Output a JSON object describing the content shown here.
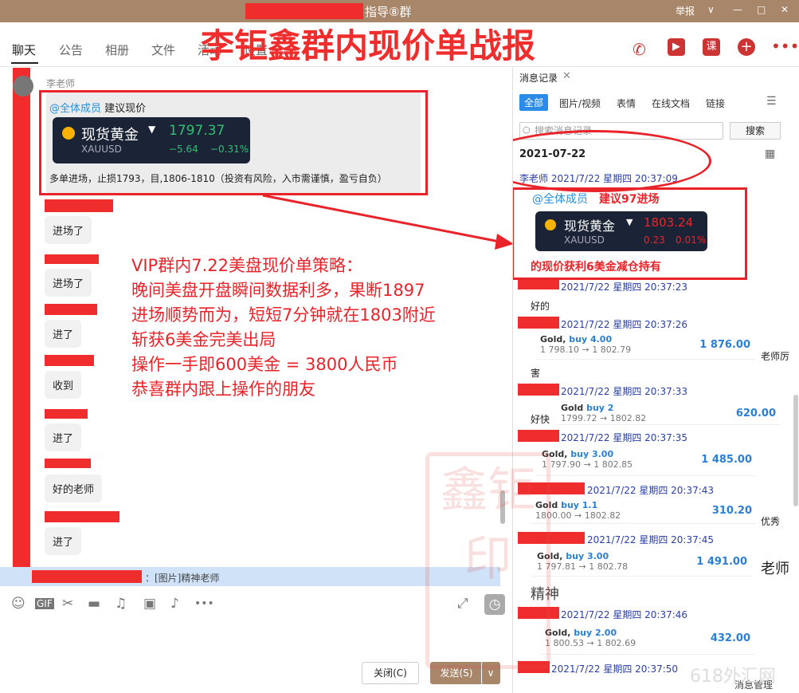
{
  "window": {
    "title": "指导⑧群",
    "controls": {
      "report": "举报",
      "minimize": "—",
      "maximize": "□",
      "close": "✕",
      "dropdown": "∨"
    }
  },
  "tabs": [
    {
      "label": "聊天",
      "active": true
    },
    {
      "label": "公告"
    },
    {
      "label": "相册"
    },
    {
      "label": "文件"
    },
    {
      "label": "活动"
    },
    {
      "label": "设置"
    }
  ],
  "overlay": {
    "title": "李钜鑫群内现价单战报",
    "strategy": [
      "VIP群内7.22美盘现价单策略：",
      "晚间美盘开盘瞬间数据利多，果断1897",
      "进场顺势而为，短短7分钟就在1803附近",
      "斩获6美金完美出局",
      "操作一手即600美金 = 3800人民币",
      "恭喜群内跟上操作的朋友"
    ]
  },
  "main_message": {
    "sender": "李老师",
    "mention": "@全体成员",
    "mention_text": "建议现价",
    "card": {
      "name": "现货黄金",
      "code": "XAUUSD",
      "price": "1797.37",
      "change": "−5.64",
      "change_pct": "−0.31%",
      "color": "#2fbf71"
    },
    "note": "多单进场，止损1793，目,1806-1810（投资有风险，入市需谨慎，盈亏自负）"
  },
  "replies": [
    "进场了",
    "进场了",
    "进了",
    "收到",
    "进了",
    "好的老师",
    "进了"
  ],
  "status_line": {
    "text": "：[图片]精神老师"
  },
  "input_bar": {
    "icons": [
      "emoji-icon",
      "gif-icon",
      "scissors-icon",
      "folder-icon",
      "music-icon",
      "image-icon",
      "bell-icon",
      "more-icon"
    ],
    "close_label": "关闭(C)",
    "send_label": "发送(S)"
  },
  "right_panel": {
    "title": "消息记录",
    "tabs": [
      "全部",
      "图片/视频",
      "表情",
      "在线文档",
      "链接"
    ],
    "search_placeholder": "搜索消息记录",
    "search_label": "搜索",
    "date": "2021-07-22",
    "first_msg": {
      "meta": "李老师 2021/7/22 星期四 20:37:09",
      "mention": "@全体成员",
      "red_text": "建议97进场",
      "card": {
        "name": "现货黄金",
        "code": "XAUUSD",
        "price": "1803.24",
        "change": "0.23",
        "change_pct": "0.01%",
        "color": "#e8242a"
      },
      "annotation": "的现价获利6美金减仓持有"
    },
    "records": [
      {
        "meta": "2021/7/22 星期四 20:37:23",
        "text": "好的"
      },
      {
        "meta": "2021/7/22 星期四 20:37:26",
        "trade": {
          "sym": "Gold,",
          "side": "buy 4.00",
          "range": "1 798.10 → 1 802.79",
          "profit": "1 876.00"
        },
        "text": "老师厉",
        "tail": "害"
      },
      {
        "meta": "2021/7/22 星期四 20:37:33",
        "trade": {
          "sym": "Gold",
          "side": "buy 2",
          "range": "1799.72 → 1802.82",
          "profit": "620.00"
        },
        "text": "好快"
      },
      {
        "meta": "2021/7/22 星期四 20:37:35",
        "trade": {
          "sym": "Gold,",
          "side": "buy 3.00",
          "range": "1 797.90 → 1 802.85",
          "profit": "1 485.00"
        }
      },
      {
        "meta": "2021/7/22 星期四 20:37:43",
        "trade": {
          "sym": "Gold",
          "side": "buy 1.1",
          "range": "1800.00 → 1802.82",
          "profit": "310.20"
        },
        "text": "优秀"
      },
      {
        "meta": "2021/7/22 星期四 20:37:45",
        "trade": {
          "sym": "Gold,",
          "side": "buy 3.00",
          "range": "1 797.81 → 1 802.78",
          "profit": "1 491.00"
        },
        "text": "老师",
        "tail": "精神"
      },
      {
        "meta": "2021/7/22 星期四 20:37:46",
        "trade": {
          "sym": "Gold,",
          "side": "buy 2.00",
          "range": "1 800.53 → 1 802.69",
          "profit": "432.00"
        }
      },
      {
        "meta": "2021/7/22 星期四 20:37:50"
      }
    ],
    "footer": "消息管理"
  },
  "watermark": {
    "text": "鑫钜印",
    "site": "618外汇网"
  }
}
